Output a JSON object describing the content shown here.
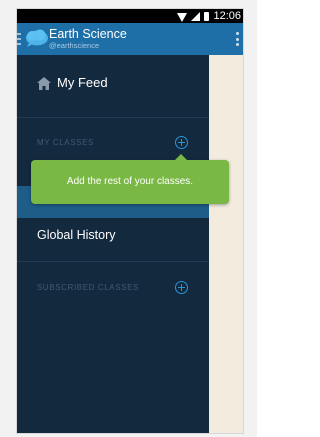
{
  "status_bar": {
    "time": "12:06"
  },
  "app_bar": {
    "title": "Earth Science",
    "handle": "@earthscience"
  },
  "drawer": {
    "feed_label": "My Feed",
    "my_classes_header": "MY CLASSES",
    "classes": [
      "Global History"
    ],
    "subscribed_header": "SUBSCRIBED CLASSES"
  },
  "tooltip": {
    "text": "Add the rest of your classes."
  },
  "colors": {
    "app_bar": "#1e6fa8",
    "drawer_bg": "#13293d",
    "selected_row": "#1e5d87",
    "tooltip_bg": "#79b844",
    "accent": "#2a95d6",
    "content_bg": "#f3ebde"
  },
  "icons": {
    "home": "home-icon",
    "add": "plus-circle-icon",
    "overflow": "overflow-menu-icon",
    "logo": "cloud-logo-icon"
  }
}
